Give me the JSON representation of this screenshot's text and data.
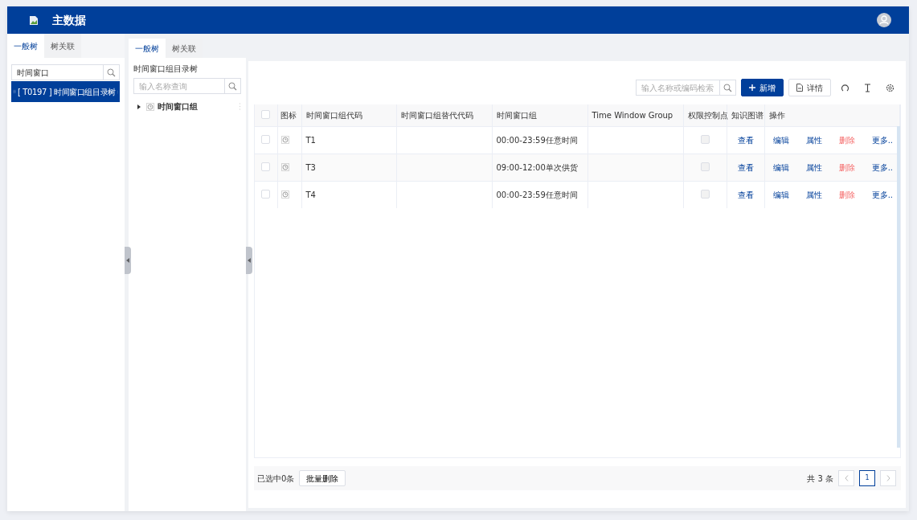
{
  "header": {
    "title": "主数据"
  },
  "left_panel": {
    "tabs": [
      {
        "label": "一般树",
        "selected": true
      },
      {
        "label": "树关联",
        "selected": false
      }
    ],
    "search": {
      "value": "时间窗口"
    },
    "tree": [
      {
        "label": "[ T0197 ] 时间窗口组目录树",
        "selected": true
      }
    ]
  },
  "middle_panel": {
    "tabs": [
      {
        "label": "一般树",
        "selected": true
      },
      {
        "label": "树关联",
        "selected": false
      }
    ],
    "heading": "时间窗口组目录树",
    "search": {
      "placeholder": "输入名称查询"
    },
    "tree": [
      {
        "label": "时间窗口组",
        "expanded": false
      }
    ]
  },
  "toolbar": {
    "search": {
      "placeholder": "输入名称或编码检索"
    },
    "buttons": [
      {
        "label": "新增",
        "kind": "primary"
      },
      {
        "label": "详情",
        "kind": "detail"
      }
    ]
  },
  "table": {
    "header_checked": false,
    "columns": [
      "图标",
      "时间窗口组代码",
      "时间窗口组替代代码",
      "时间窗口组",
      "Time Window Group",
      "权限控制点",
      "知识图谱",
      "操作"
    ],
    "rows": [
      {
        "checked": false,
        "code": "T1",
        "group": "00:00-23:59任意时间",
        "permission": {
          "checked": false,
          "disabled": true
        },
        "graph": "查看",
        "actions": [
          {
            "label": "编辑",
            "kind": "normal"
          },
          {
            "label": "属性",
            "kind": "normal"
          },
          {
            "label": "删除",
            "kind": "danger"
          },
          {
            "label": "更多..",
            "kind": "normal"
          }
        ]
      },
      {
        "checked": false,
        "code": "T3",
        "group": "09:00-12:00单次供货",
        "permission": {
          "checked": false,
          "disabled": true
        },
        "graph": "查看",
        "actions": [
          {
            "label": "编辑",
            "kind": "normal"
          },
          {
            "label": "属性",
            "kind": "normal"
          },
          {
            "label": "删除",
            "kind": "danger"
          },
          {
            "label": "更多..",
            "kind": "normal"
          }
        ]
      },
      {
        "checked": false,
        "code": "T4",
        "group": "00:00-23:59任意时间",
        "permission": {
          "checked": false,
          "disabled": true
        },
        "graph": "查看",
        "actions": [
          {
            "label": "编辑",
            "kind": "normal"
          },
          {
            "label": "属性",
            "kind": "normal"
          },
          {
            "label": "删除",
            "kind": "danger"
          },
          {
            "label": "更多..",
            "kind": "normal"
          }
        ]
      }
    ]
  },
  "footer": {
    "selected_count": "已选中0条",
    "batch_button": "批量删除",
    "total": "共 3 条",
    "pages": [
      {
        "label": "1",
        "selected": true
      }
    ]
  }
}
